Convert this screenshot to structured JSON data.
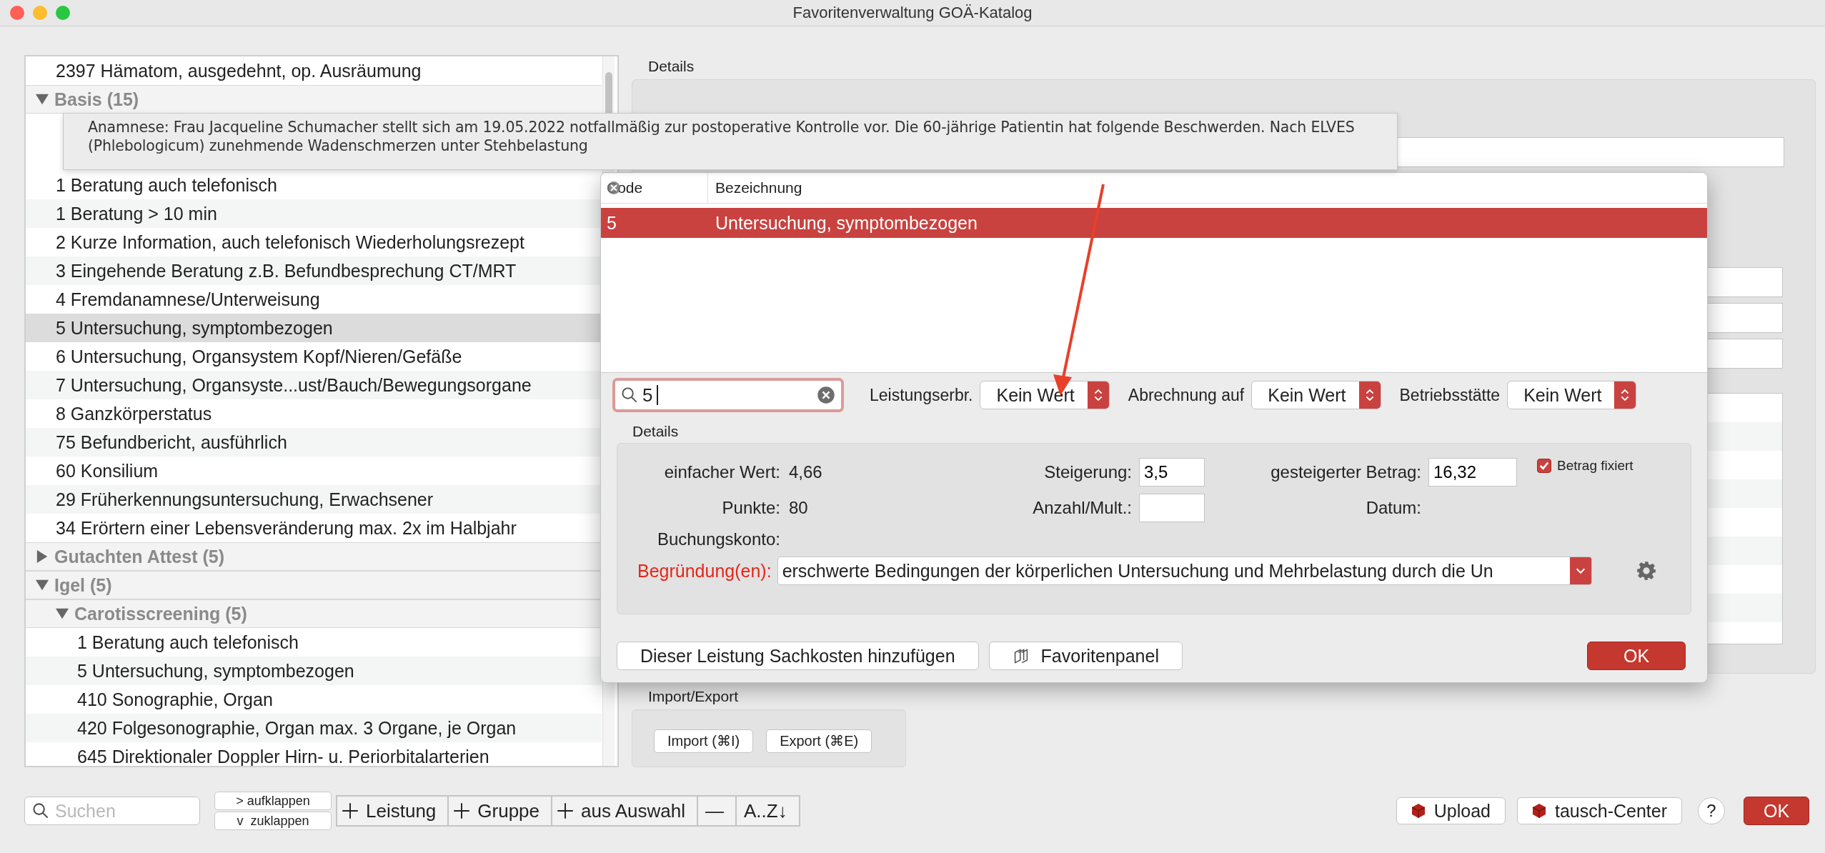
{
  "window": {
    "title": "Favoritenverwaltung GOÄ-Katalog"
  },
  "tree": [
    {
      "label": "2397 Hämatom, ausgedehnt, op. Ausräumung",
      "kind": "item",
      "selected": false
    },
    {
      "label": "Basis (15)",
      "kind": "group",
      "expanded": true,
      "children": [
        {
          "label": "1 Beratung auch telefonisch",
          "kind": "item",
          "selected": false
        },
        {
          "label": "1 Beratung > 10 min",
          "kind": "item",
          "selected": false
        },
        {
          "label": "2 Kurze Information, auch telefonisch Wiederholungsrezept",
          "kind": "item",
          "selected": false
        },
        {
          "label": "3 Eingehende Beratung z.B. Befundbesprechung CT/MRT",
          "kind": "item",
          "selected": false
        },
        {
          "label": "4 Fremdanamnese/Unterweisung",
          "kind": "item",
          "selected": false
        },
        {
          "label": "5 Untersuchung, symptombezogen",
          "kind": "item",
          "selected": true
        },
        {
          "label": "6 Untersuchung, Organsystem Kopf/Nieren/Gefäße",
          "kind": "item",
          "selected": false
        },
        {
          "label": "7 Untersuchung, Organsyste...ust/Bauch/Bewegungsorgane",
          "kind": "item",
          "selected": false
        },
        {
          "label": "8 Ganzkörperstatus",
          "kind": "item",
          "selected": false
        },
        {
          "label": "75 Befundbericht, ausführlich",
          "kind": "item",
          "selected": false
        },
        {
          "label": "60 Konsilium",
          "kind": "item",
          "selected": false
        },
        {
          "label": "29 Früherkennungsuntersuchung, Erwachsener",
          "kind": "item",
          "selected": false
        },
        {
          "label": "34 Erörtern einer Lebensveränderung max. 2x im Halbjahr",
          "kind": "item",
          "selected": false
        }
      ]
    },
    {
      "label": "Gutachten Attest (5)",
      "kind": "group",
      "expanded": false
    },
    {
      "label": "Igel (5)",
      "kind": "group",
      "expanded": true,
      "children": [
        {
          "label": "Carotisscreening (5)",
          "kind": "group",
          "expanded": true,
          "children": [
            {
              "label": "1 Beratung auch telefonisch",
              "kind": "item",
              "selected": false
            },
            {
              "label": "5 Untersuchung, symptombezogen",
              "kind": "item",
              "selected": false
            },
            {
              "label": "410 Sonographie, Organ",
              "kind": "item",
              "selected": false
            },
            {
              "label": "420 Folgesonographie, Organ max. 3 Organe, je Organ",
              "kind": "item",
              "selected": false
            },
            {
              "label": "645 Direktionaler Doppler Hirn- u. Periorbitalarterien",
              "kind": "item",
              "selected": false
            }
          ]
        }
      ]
    }
  ],
  "tooltip": {
    "lines": [
      "Anamnese: Frau Jacqueline Schumacher stellt sich am 19.05.2022 notfallmäßig zur postoperative Kontrolle vor. Die 60-jährige Patientin hat folgende Beschwerden. Nach ELVES",
      "(Phlebologicum) zunehmende Wadenschmerzen unter Stehbelastung"
    ]
  },
  "details": {
    "title": "Details"
  },
  "import_export": {
    "title": "Import/Export",
    "buttons": [
      "Import (⌘I)",
      "Export (⌘E)"
    ]
  },
  "toolbar": {
    "search": {
      "placeholder": "Suchen"
    },
    "expand_buttons": [
      "> aufklappen",
      "v  zuklappen"
    ],
    "segments": [
      {
        "kind": "add",
        "label": "Leistung"
      },
      {
        "kind": "add",
        "label": "Gruppe"
      },
      {
        "kind": "add",
        "label": "aus Auswahl"
      },
      {
        "kind": "text",
        "label": "—"
      },
      {
        "kind": "text",
        "label": "A..Z↓"
      }
    ]
  },
  "footer_buttons": [
    {
      "kind": "icon",
      "label": "Upload"
    },
    {
      "kind": "icon",
      "label": "tausch-Center"
    },
    {
      "kind": "help",
      "label": "?"
    },
    {
      "kind": "default",
      "label": "OK"
    }
  ],
  "popup": {
    "columns": [
      "Code",
      "Bezeichnung"
    ],
    "rows": [
      {
        "code": "5",
        "name": "Untersuchung, symptombezogen",
        "selected": true
      }
    ],
    "search": {
      "value": "5"
    },
    "filters": [
      {
        "label": "Leistungserbr.",
        "value": "Kein Wert"
      },
      {
        "label": "Abrechnung auf",
        "value": "Kein Wert"
      },
      {
        "label": "Betriebsstätte",
        "value": "Kein Wert"
      }
    ],
    "details_title": "Details",
    "einfacher_wert": {
      "label": "einfacher Wert:",
      "value": "4,66"
    },
    "steigerung": {
      "label": "Steigerung:",
      "value": "3,5"
    },
    "gesteigerter_betrag": {
      "label": "gesteigerter Betrag:",
      "value": "16,32"
    },
    "betrag_fixiert": {
      "label": "Betrag fixiert",
      "checked": true
    },
    "punkte": {
      "label": "Punkte:",
      "value": "80"
    },
    "anzahl": {
      "label": "Anzahl/Mult.:"
    },
    "datum": {
      "label": "Datum:"
    },
    "buchungskonto": {
      "label": "Buchungskonto:"
    },
    "reason": {
      "label": "Begründung(en):",
      "value": "erschwerte Bedingungen der körperlichen Untersuchung und Mehrbelastung durch die Un"
    },
    "buttons": [
      {
        "kind": "plain",
        "label": "Dieser Leistung Sachkosten hinzufügen"
      },
      {
        "kind": "panel",
        "label": "Favoritenpanel"
      },
      {
        "kind": "default",
        "label": "OK"
      }
    ]
  }
}
